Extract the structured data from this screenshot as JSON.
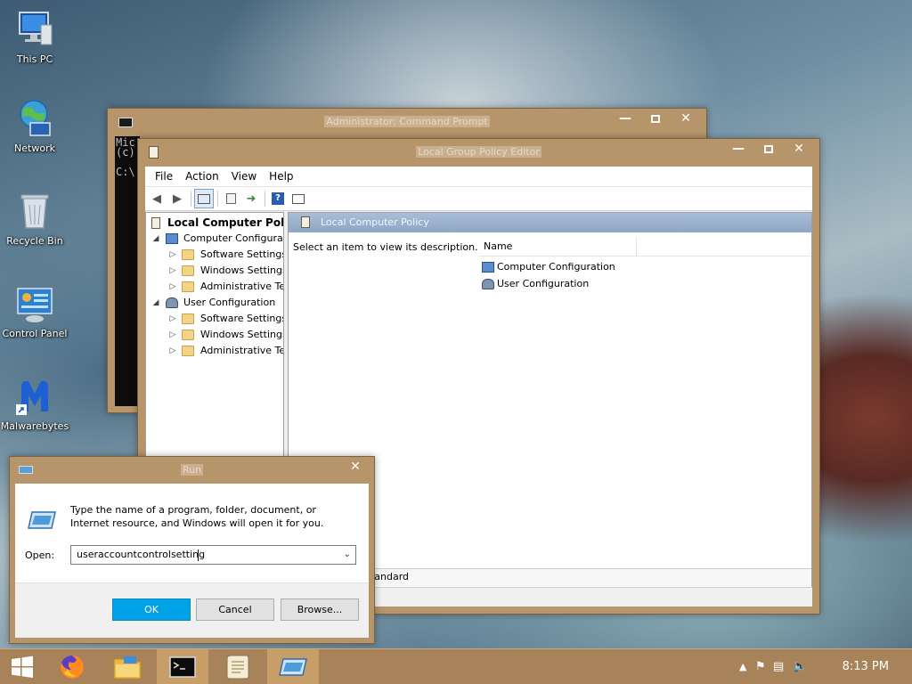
{
  "desktop": {
    "icons": [
      {
        "label": "This PC"
      },
      {
        "label": "Network"
      },
      {
        "label": "Recycle Bin"
      },
      {
        "label": "Control Panel"
      },
      {
        "label": "Malwarebytes"
      }
    ]
  },
  "cmd_window": {
    "title": "Administrator: Command Prompt",
    "console_lines": [
      "Mic",
      "(c)",
      "",
      "C:\\"
    ]
  },
  "gpedit_window": {
    "title": "Local Group Policy Editor",
    "menu": [
      "File",
      "Action",
      "View",
      "Help"
    ],
    "tree": {
      "root": "Local Computer Policy",
      "computer_config": "Computer Configuration",
      "computer_children": [
        "Software Settings",
        "Windows Settings",
        "Administrative Templates"
      ],
      "user_config": "User Configuration",
      "user_children": [
        "Software Settings",
        "Windows Settings",
        "Administrative Templates"
      ]
    },
    "right_pane": {
      "header": "Local Computer Policy",
      "description": "Select an item to view its description.",
      "column_name": "Name",
      "items": [
        "Computer Configuration",
        "User Configuration"
      ]
    },
    "status_tab": "Standard"
  },
  "run_dialog": {
    "title": "Run",
    "description": "Type the name of a program, folder, document, or Internet resource, and Windows will open it for you.",
    "open_label": "Open:",
    "open_value": "useraccountcontrolsetting",
    "ok": "OK",
    "cancel": "Cancel",
    "browse": "Browse..."
  },
  "taskbar": {
    "clock": "8:13 PM"
  },
  "colors": {
    "window_frame": "#b7956b",
    "taskbar": "#a8835a",
    "ok_button": "#00a2e8"
  }
}
